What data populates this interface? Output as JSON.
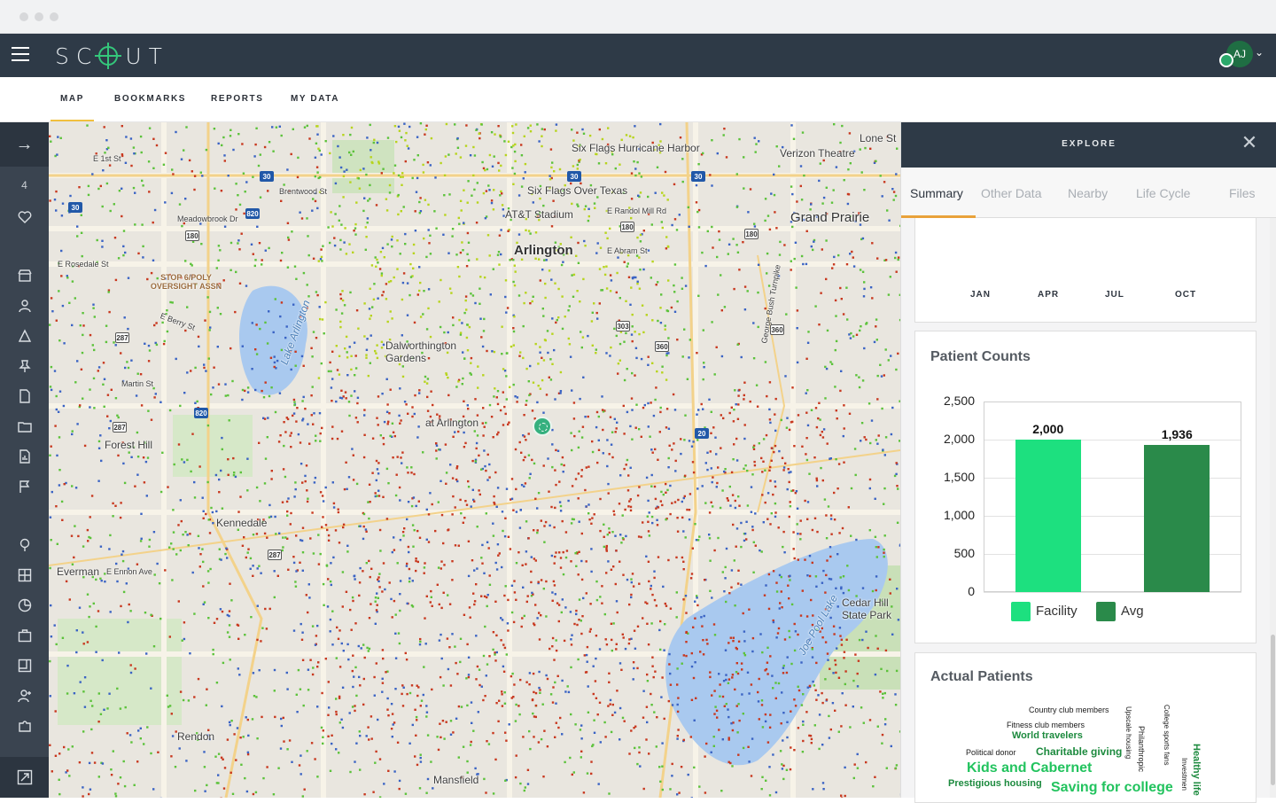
{
  "app": {
    "logo_text": "SCOUT",
    "user_initials": "AJ"
  },
  "nav": {
    "tabs": [
      "MAP",
      "BOOKMARKS",
      "REPORTS",
      "MY DATA"
    ]
  },
  "rail": {
    "count": "4"
  },
  "map": {
    "labels": {
      "six_flags": "Six Flags Hurricane Harbor",
      "six_flags_tx": "Six Flags Over Texas",
      "att": "AT&T Stadium",
      "arlington": "Arlington",
      "grand_prairie": "Grand Prairie",
      "lone_star": "Lone St",
      "verizon": "Verizon Theatre",
      "stop6": "STOP 6/POLY OVERSIGHT ASSN",
      "lake_arlington": "Lake Arlington",
      "dalworthington": "Dalworthington Gardens",
      "forest_hill": "Forest Hill",
      "kennedale": "Kennedale",
      "everman": "Everman",
      "rendon": "Rendon",
      "mansfield": "Mansfield",
      "joe_pool": "Joe Pool Lake",
      "cedar_hill": "Cedar Hill State Park",
      "bush_turnpike": "George Bush Turnpike",
      "e_1st": "E 1st St",
      "rosedale": "E Rosedale St",
      "berry": "E Berry St",
      "martin": "Martin St",
      "meadowbrook": "Meadowbrook Dr",
      "brentwood": "Brentwood St",
      "randol": "E Randol Mill Rd",
      "abram": "E Abram St",
      "ennon": "E Ennon Ave",
      "at_arlington": "at Arlington"
    },
    "shields": {
      "i30a": "30",
      "i30b": "30",
      "i30c": "30",
      "i30d": "30",
      "i820a": "820",
      "i820b": "820",
      "s180a": "180",
      "s180b": "180",
      "s180c": "180",
      "s287a": "287",
      "s287b": "287",
      "s287c": "287",
      "s303": "303",
      "s360": "360",
      "s20": "20",
      "s360b": "360"
    }
  },
  "panel": {
    "title": "EXPLORE",
    "tabs": [
      "Summary",
      "Other Data",
      "Nearby",
      "Life Cycle",
      "Files"
    ],
    "months": [
      "JAN",
      "APR",
      "JUL",
      "OCT"
    ],
    "patient_counts_title": "Patient Counts",
    "actual_patients_title": "Actual Patients",
    "word_cloud": [
      "Country club members",
      "Fitness club members",
      "World travelers",
      "Political donor",
      "Charitable giving",
      "Kids and Cabernet",
      "Prestigious housing",
      "Saving for college",
      "Upscale housing",
      "Philanthropic",
      "College sports fans",
      "Healthy life",
      "Investmen"
    ]
  },
  "chart_data": {
    "type": "bar",
    "title": "Patient Counts",
    "categories": [
      "Facility",
      "Avg"
    ],
    "values": [
      2000,
      1936
    ],
    "value_labels": [
      "2,000",
      "1,936"
    ],
    "ylim": [
      0,
      2500
    ],
    "yticks": [
      "0",
      "500",
      "1,000",
      "1,500",
      "2,000",
      "2,500"
    ],
    "colors": [
      "#1de07f",
      "#2a8a4a"
    ],
    "legend": [
      "Facility",
      "Avg"
    ],
    "legend_position": "bottom"
  }
}
